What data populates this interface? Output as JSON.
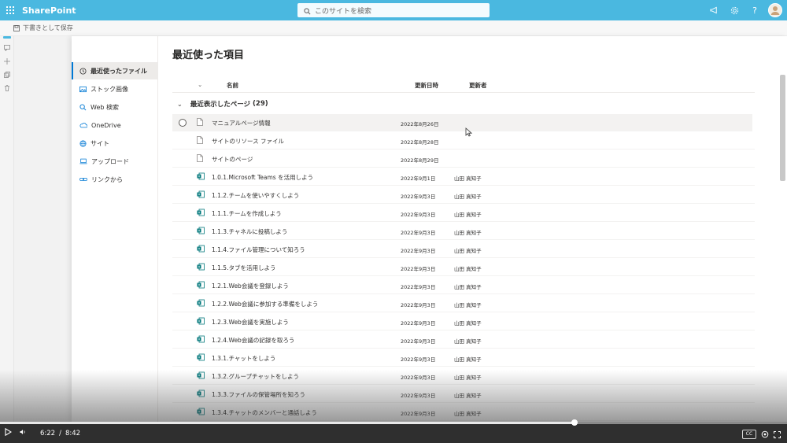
{
  "suite": {
    "app_name": "SharePoint",
    "search_placeholder": "このサイトを検索",
    "icons": [
      "waffle-icon",
      "megaphone-icon",
      "gear-icon",
      "help-icon",
      "avatar"
    ],
    "accent": "#4ab8e0"
  },
  "command_bar": {
    "save_draft_label": "下書きとして保存"
  },
  "nav": {
    "items": [
      {
        "label": "最近使ったファイル",
        "icon": "clock-icon",
        "active": true
      },
      {
        "label": "ストック画像",
        "icon": "image-icon",
        "active": false
      },
      {
        "label": "Web 検索",
        "icon": "search-icon",
        "active": false
      },
      {
        "label": "OneDrive",
        "icon": "cloud-icon",
        "active": false
      },
      {
        "label": "サイト",
        "icon": "globe-icon",
        "active": false
      },
      {
        "label": "アップロード",
        "icon": "laptop-icon",
        "active": false
      },
      {
        "label": "リンクから",
        "icon": "link-icon",
        "active": false
      }
    ]
  },
  "main": {
    "title": "最近使った項目",
    "columns": {
      "name": "名前",
      "modified": "更新日時",
      "modified_by": "更新者"
    },
    "group": {
      "label": "最近表示したページ",
      "count": "(29)"
    },
    "rows": [
      {
        "name": "マニュアルページ情報",
        "date": "2022年8月26日",
        "by": "",
        "type": "page"
      },
      {
        "name": "サイトのリソース ファイル",
        "date": "2022年8月28日",
        "by": "",
        "type": "page"
      },
      {
        "name": "サイトのページ",
        "date": "2022年8月29日",
        "by": "",
        "type": "page"
      },
      {
        "name": "1.0.1.Microsoft Teams を活用しよう",
        "date": "2022年9月1日",
        "by": "山田 真知子",
        "type": "sitepage"
      },
      {
        "name": "1.1.2.チームを使いやすくしよう",
        "date": "2022年9月3日",
        "by": "山田 真知子",
        "type": "sitepage"
      },
      {
        "name": "1.1.1.チームを作成しよう",
        "date": "2022年9月3日",
        "by": "山田 真知子",
        "type": "sitepage"
      },
      {
        "name": "1.1.3.チャネルに投稿しよう",
        "date": "2022年9月3日",
        "by": "山田 真知子",
        "type": "sitepage"
      },
      {
        "name": "1.1.4.ファイル管理について知ろう",
        "date": "2022年9月3日",
        "by": "山田 真知子",
        "type": "sitepage"
      },
      {
        "name": "1.1.5.タブを活用しよう",
        "date": "2022年9月3日",
        "by": "山田 真知子",
        "type": "sitepage"
      },
      {
        "name": "1.2.1.Web会議を登録しよう",
        "date": "2022年9月3日",
        "by": "山田 真知子",
        "type": "sitepage"
      },
      {
        "name": "1.2.2.Web会議に参加する準備をしよう",
        "date": "2022年9月3日",
        "by": "山田 真知子",
        "type": "sitepage"
      },
      {
        "name": "1.2.3.Web会議を実施しよう",
        "date": "2022年9月3日",
        "by": "山田 真知子",
        "type": "sitepage"
      },
      {
        "name": "1.2.4.Web会議の記録を取ろう",
        "date": "2022年9月3日",
        "by": "山田 真知子",
        "type": "sitepage"
      },
      {
        "name": "1.3.1.チャットをしよう",
        "date": "2022年9月3日",
        "by": "山田 真知子",
        "type": "sitepage"
      },
      {
        "name": "1.3.2.グループチャットをしよう",
        "date": "2022年9月3日",
        "by": "山田 真知子",
        "type": "sitepage"
      },
      {
        "name": "1.3.3.ファイルの保管場所を知ろう",
        "date": "2022年9月3日",
        "by": "山田 真知子",
        "type": "sitepage"
      },
      {
        "name": "1.3.4.チャットのメンバーと通話しよう",
        "date": "2022年9月3日",
        "by": "山田 真知子",
        "type": "sitepage"
      }
    ]
  },
  "player": {
    "current_time": "6:22",
    "separator": "/",
    "duration": "8:42",
    "progress": 0.73,
    "cc_label": "CC"
  }
}
